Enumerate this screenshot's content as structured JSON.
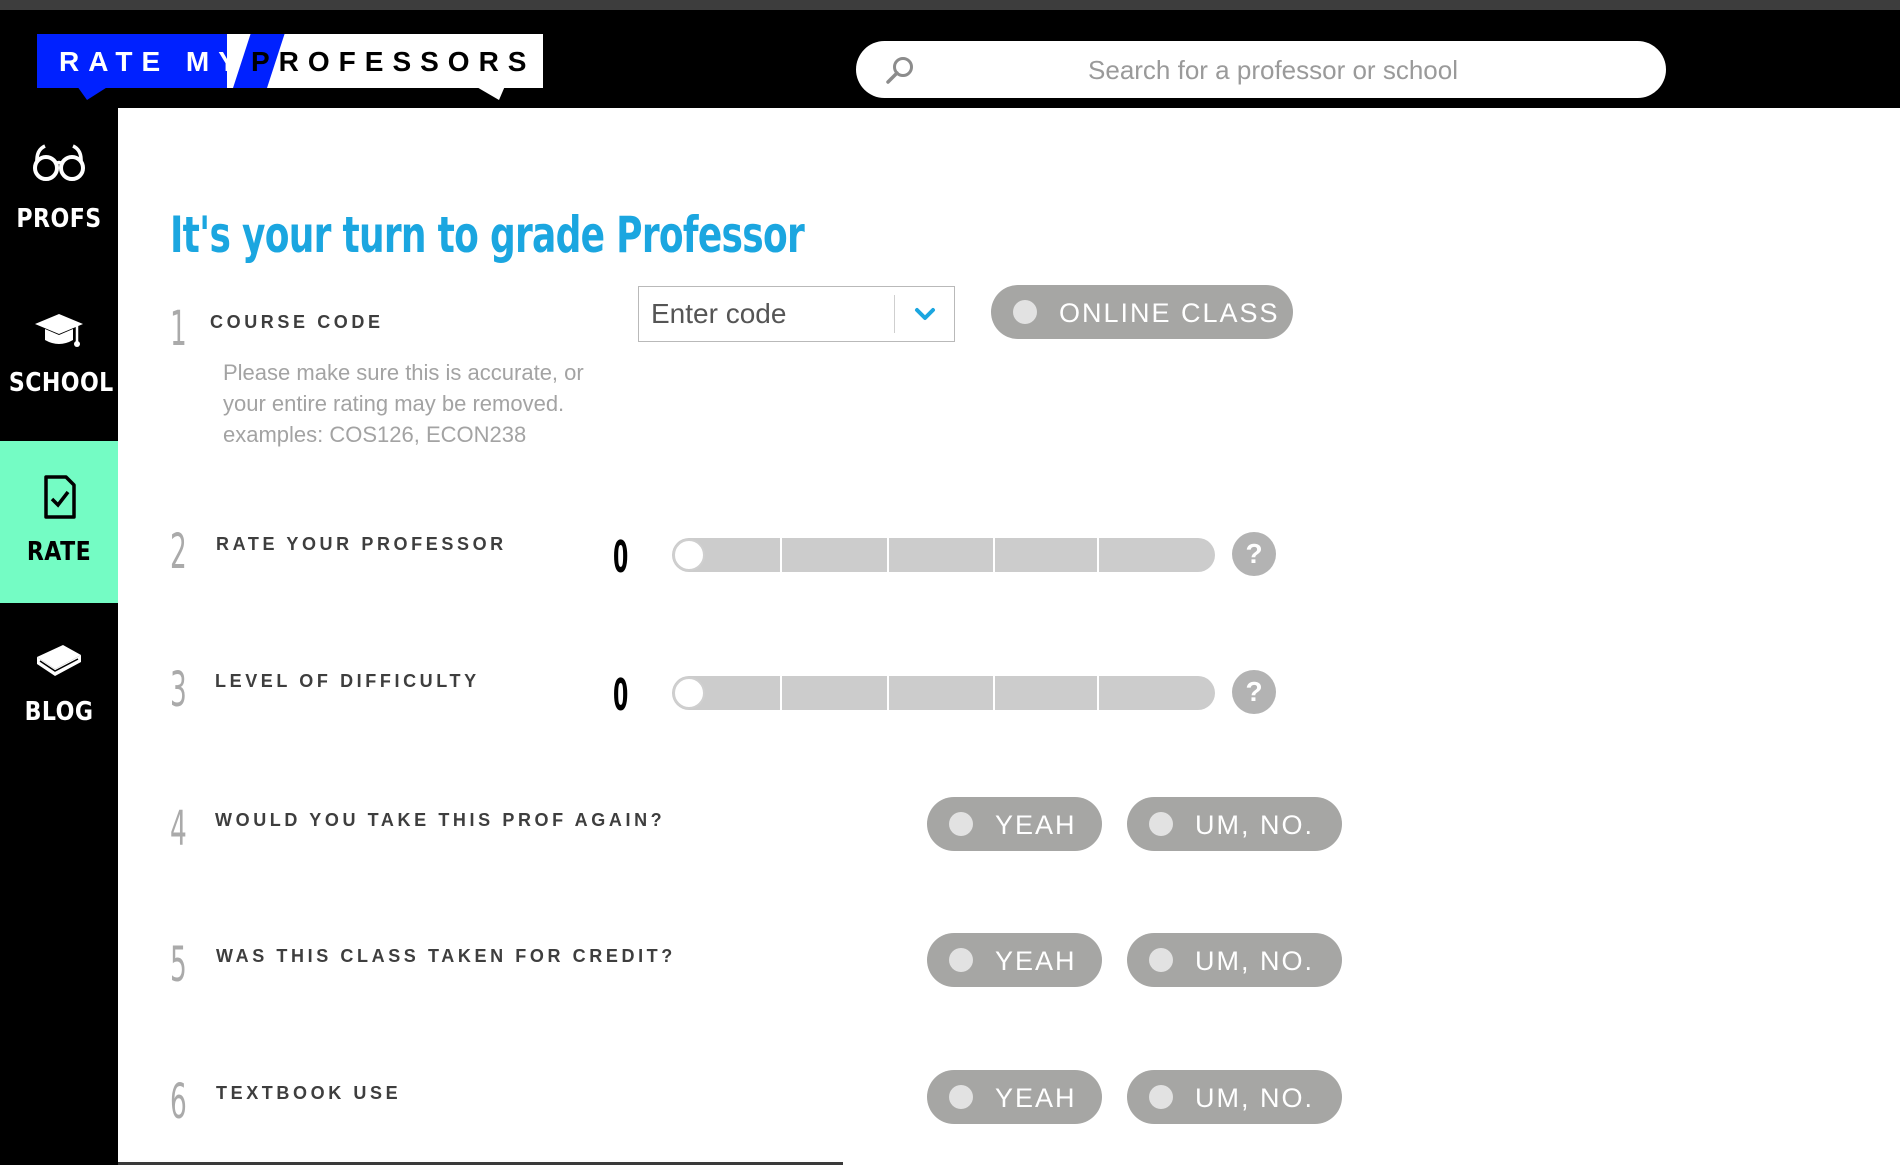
{
  "logo": {
    "part1": "RATE MY",
    "part2": "PROFESSORS"
  },
  "search": {
    "placeholder": "Search for a professor or school"
  },
  "sidebar": {
    "items": [
      {
        "label": "PROFS",
        "icon": "glasses-icon",
        "active": false
      },
      {
        "label": "SCHOOL",
        "icon": "graduation-cap-icon",
        "active": false
      },
      {
        "label": "RATE",
        "icon": "rate-document-icon",
        "active": true
      },
      {
        "label": "BLOG",
        "icon": "book-icon",
        "active": false
      }
    ]
  },
  "main": {
    "title": "It's your turn to grade Professor",
    "questions": [
      {
        "number": "1",
        "label": "COURSE CODE",
        "help": "Please make sure this is accurate, or your entire rating may be removed. examples: COS126, ECON238",
        "code_placeholder": "Enter code",
        "online_label": "ONLINE CLASS"
      },
      {
        "number": "2",
        "label": "RATE YOUR PROFESSOR",
        "value": "0",
        "help_icon": "?"
      },
      {
        "number": "3",
        "label": "LEVEL OF DIFFICULTY",
        "value": "0",
        "help_icon": "?"
      },
      {
        "number": "4",
        "label": "WOULD YOU TAKE THIS PROF AGAIN?",
        "yes": "YEAH",
        "no": "UM, NO."
      },
      {
        "number": "5",
        "label": "WAS THIS CLASS TAKEN FOR CREDIT?",
        "yes": "YEAH",
        "no": "UM, NO."
      },
      {
        "number": "6",
        "label": "TEXTBOOK USE",
        "yes": "YEAH",
        "no": "UM, NO."
      }
    ]
  },
  "colors": {
    "accent_blue": "#1ba6e0",
    "logo_blue": "#0021ff",
    "active_nav": "#74fcc4",
    "pill_gray": "#a6a6a4"
  }
}
